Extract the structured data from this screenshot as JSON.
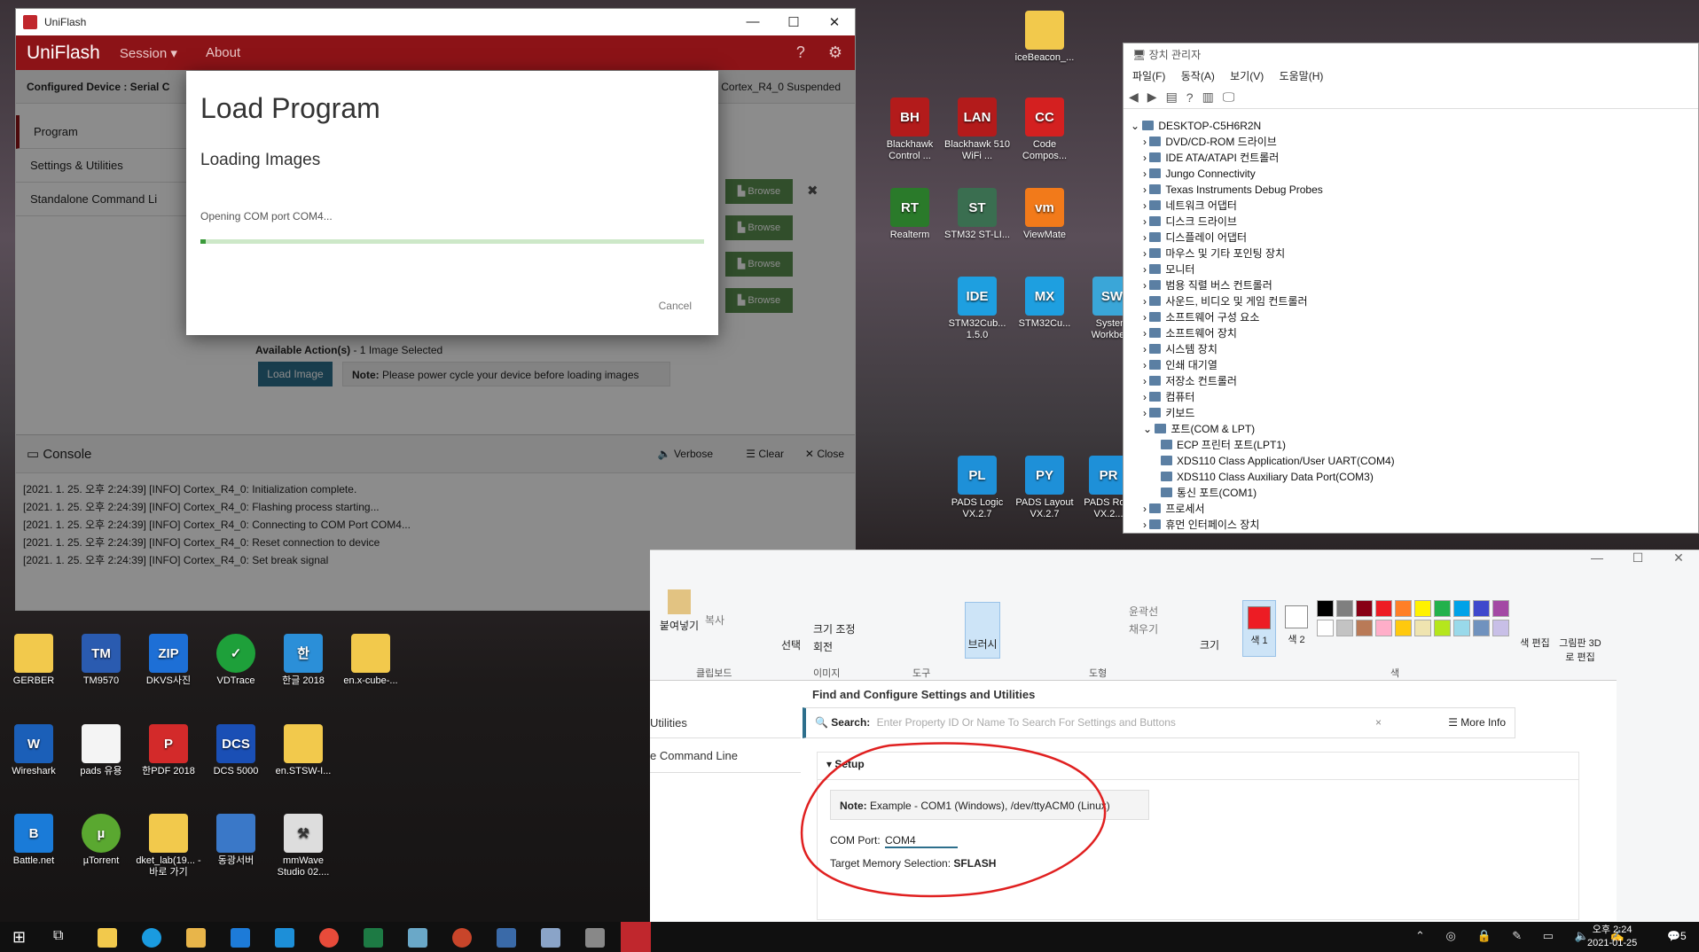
{
  "desktop_icons": [
    {
      "label": "iceBeacon_..."
    },
    {
      "label": "Blackhawk Control ..."
    },
    {
      "label": "Blackhawk 510 WiFi ..."
    },
    {
      "label": "Code Compos..."
    },
    {
      "label": "Realterm"
    },
    {
      "label": "STM32 ST-LI..."
    },
    {
      "label": "ViewMate"
    },
    {
      "label": "STM32Cub... 1.5.0"
    },
    {
      "label": "STM32Cu..."
    },
    {
      "label": "System Workbe..."
    },
    {
      "label": "PADS Logic VX.2.7"
    },
    {
      "label": "PADS Layout VX.2.7"
    },
    {
      "label": "PADS Ro... VX.2..."
    },
    {
      "label": "GERBER"
    },
    {
      "label": "TM9570"
    },
    {
      "label": "DKVS사진"
    },
    {
      "label": "VDTrace"
    },
    {
      "label": "한글 2018"
    },
    {
      "label": "en.x-cube-..."
    },
    {
      "label": "Wireshark"
    },
    {
      "label": "pads 유용"
    },
    {
      "label": "한PDF 2018"
    },
    {
      "label": "DCS 5000"
    },
    {
      "label": "en.STSW-I..."
    },
    {
      "label": "Battle.net"
    },
    {
      "label": "µTorrent"
    },
    {
      "label": "dket_lab(19... - 바로 가기"
    },
    {
      "label": "동광서버"
    },
    {
      "label": "mmWave Studio 02...."
    }
  ],
  "uniflash": {
    "title": "UniFlash",
    "brand": "UniFlash",
    "menu_session": "Session",
    "menu_about": "About",
    "configured_device": "Configured Device : Serial C",
    "status": "Cortex_R4_0 Suspended",
    "sidebar": [
      "Program",
      "Settings & Utilities",
      "Standalone Command Li"
    ],
    "browse": "Browse",
    "available_label": "Available Action(s)",
    "available_note": " - 1 Image Selected",
    "load_image": "Load Image",
    "note_label": "Note:",
    "note_text": "Please power cycle your device before loading images",
    "console": {
      "title": "Console",
      "verbose": "Verbose",
      "clear": "Clear",
      "close": "Close",
      "lines": [
        "[2021. 1. 25. 오후 2:24:39] [INFO] Cortex_R4_0: Initialization complete.",
        "[2021. 1. 25. 오후 2:24:39] [INFO] Cortex_R4_0: Flashing process starting...",
        "[2021. 1. 25. 오후 2:24:39] [INFO] Cortex_R4_0: Connecting to COM Port COM4...",
        "[2021. 1. 25. 오후 2:24:39] [INFO] Cortex_R4_0: Reset connection to device",
        "[2021. 1. 25. 오후 2:24:39] [INFO] Cortex_R4_0: Set break signal"
      ]
    },
    "modal": {
      "title": "Load Program",
      "subtitle": "Loading Images",
      "status": "Opening COM port COM4...",
      "progress": 0.01,
      "cancel": "Cancel"
    }
  },
  "device_manager": {
    "title": "장치 관리자",
    "menu": [
      "파일(F)",
      "동작(A)",
      "보기(V)",
      "도움말(H)"
    ],
    "root": "DESKTOP-C5H6R2N",
    "items": [
      "DVD/CD-ROM 드라이브",
      "IDE ATA/ATAPI 컨트롤러",
      "Jungo Connectivity",
      "Texas Instruments Debug Probes",
      "네트워크 어댑터",
      "디스크 드라이브",
      "디스플레이 어댑터",
      "마우스 및 기타 포인팅 장치",
      "모니터",
      "범용 직렬 버스 컨트롤러",
      "사운드, 비디오 및 게임 컨트롤러",
      "소프트웨어 구성 요소",
      "소프트웨어 장치",
      "시스템 장치",
      "인쇄 대기열",
      "저장소 컨트롤러",
      "컴퓨터",
      "키보드",
      "포트(COM & LPT)"
    ],
    "ports": [
      "ECP 프린터 포트(LPT1)",
      "XDS110 Class Application/User UART(COM4)",
      "XDS110 Class Auxiliary Data Port(COM3)",
      "통신 포트(COM1)"
    ],
    "after": [
      "프로세서",
      "휴먼 인터페이스 장치"
    ]
  },
  "paint": {
    "labels": {
      "paste": "붙여넣기",
      "copy": "복사",
      "clipboard": "클립보드",
      "select": "선택",
      "resize": "크기 조정",
      "rotate": "회전",
      "image": "이미지",
      "tools": "도구",
      "brush": "브러시",
      "shapes": "도형",
      "outline": "윤곽선",
      "fill": "채우기",
      "size": "크기",
      "color1": "색 1",
      "color2": "색 2",
      "edit_colors": "색 편집",
      "paint3d": "그림판 3D로 편집",
      "colors": "색"
    },
    "palette": [
      "#000000",
      "#7f7f7f",
      "#880015",
      "#ed1c24",
      "#ff7f27",
      "#fff200",
      "#22b14c",
      "#00a2e8",
      "#3f48cc",
      "#a349a4",
      "#ffffff",
      "#c3c3c3",
      "#b97a57",
      "#ffaec9",
      "#ffc90e",
      "#efe4b0",
      "#b5e61d",
      "#99d9ea",
      "#7092be",
      "#c8bfe7"
    ],
    "color1": "#ed1c24"
  },
  "settings": {
    "header": "Find and Configure Settings and Utilities",
    "side": [
      "Utilities",
      "e Command Line"
    ],
    "search_label": "Search:",
    "search_placeholder": "Enter Property ID Or Name To Search For Settings and Buttons",
    "more_info": "More Info",
    "section": "Setup",
    "note_label": "Note:",
    "note_text": "Example - COM1 (Windows), /dev/ttyACM0 (Linux)",
    "com_label": "COM Port:",
    "com_value": "COM4",
    "target_label": "Target Memory Selection:",
    "target_value": "SFLASH"
  },
  "taskbar": {
    "time": "오후 2:24",
    "date": "2021-01-25",
    "notif": "5"
  }
}
